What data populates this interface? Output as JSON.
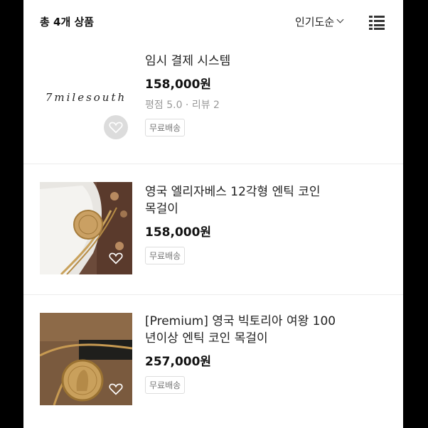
{
  "header": {
    "total_label": "총 4개 상품",
    "sort_label": "인기도순"
  },
  "products": [
    {
      "title": "임시 결제 시스템",
      "price": "158,000원",
      "rating": "평점 5.0 · 리뷰 2",
      "badge": "무료배송",
      "logo_text": "7milesouth"
    },
    {
      "title_line1": "영국 엘리자베스 12각형 엔틱 코인",
      "title_line2": "목걸이",
      "price": "158,000원",
      "badge": "무료배송"
    },
    {
      "title_line1": "[Premium] 영국 빅토리아 여왕 100",
      "title_line2": "년이상 엔틱 코인 목걸이",
      "price": "257,000원",
      "badge": "무료배송"
    }
  ],
  "icons": {
    "sort": "chevron-down-icon",
    "view": "list-view-icon",
    "wishlist": "heart-icon"
  }
}
